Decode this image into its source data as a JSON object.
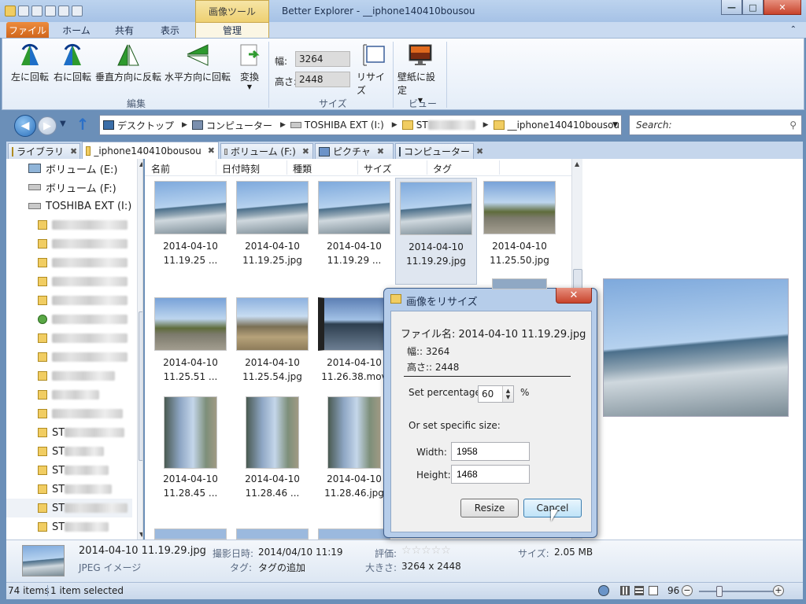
{
  "window": {
    "title": "Better Explorer - __iphone140410bousou",
    "contextual_tab_header": "画像ツール",
    "controls": {
      "minimize": "—",
      "maximize": "□",
      "close": "✕"
    }
  },
  "ribbon": {
    "tabs": [
      "ファイル",
      "ホーム",
      "共有",
      "表示",
      "管理"
    ],
    "active_tab": "管理",
    "groups": {
      "edit": {
        "label": "編集",
        "buttons": [
          "左に回転",
          "右に回転",
          "垂直方向に反転",
          "水平方向に回転",
          "変換"
        ]
      },
      "size": {
        "label": "サイズ",
        "width_label": "幅:",
        "width_value": "3264",
        "height_label": "高さ:",
        "height_value": "2448",
        "resize_label": "リサイズ"
      },
      "view": {
        "label": "ビュー",
        "wallpaper_label": "壁紙に設定"
      }
    }
  },
  "navbar": {
    "breadcrumbs": [
      "デスクトップ",
      "コンピューター",
      "TOSHIBA EXT (I:)",
      "ST",
      "__iphone140410bousou"
    ],
    "search_placeholder": "Search:"
  },
  "tabs": [
    {
      "label": "ライブラリ",
      "active": false
    },
    {
      "label": "_iphone140410bousou",
      "active": true
    },
    {
      "label": "ボリューム (F:)",
      "active": false
    },
    {
      "label": "ピクチャ",
      "active": false
    },
    {
      "label": "コンピューター",
      "active": false
    }
  ],
  "nav_pane": {
    "drives": [
      "ボリューム (E:)",
      "ボリューム (F:)",
      "TOSHIBA EXT (I:)"
    ],
    "folder_prefix": "ST"
  },
  "columns": [
    "名前",
    "日付時刻",
    "種類",
    "サイズ",
    "タグ"
  ],
  "files": [
    {
      "line1": "2014-04-10",
      "line2": "11.19.25 ...",
      "selected": false
    },
    {
      "line1": "2014-04-10",
      "line2": "11.19.25.jpg",
      "selected": false
    },
    {
      "line1": "2014-04-10",
      "line2": "11.19.29 ...",
      "selected": false
    },
    {
      "line1": "2014-04-10",
      "line2": "11.19.29.jpg",
      "selected": true
    },
    {
      "line1": "2014-04-10",
      "line2": "11.25.50.jpg",
      "selected": false
    },
    {
      "line1": "2014-04-10",
      "line2": "11.25.51 ...",
      "selected": false
    },
    {
      "line1": "2014-04-10",
      "line2": "11.25.54.jpg",
      "selected": false
    },
    {
      "line1": "2014-04-10",
      "line2": "11.26.38.mov",
      "selected": false
    },
    {
      "line1": "2014-04-10",
      "line2": "11.28.45 ...",
      "selected": false
    },
    {
      "line1": "2014-04-10",
      "line2": "11.28.46 ...",
      "selected": false
    },
    {
      "line1": "2014-04-10",
      "line2": "11.28.46.jpg",
      "selected": false
    }
  ],
  "details": {
    "filename": "2014-04-10 11.19.29.jpg",
    "type": "JPEG イメージ",
    "date_label": "撮影日時:",
    "date_value": "2014/04/10 11:19",
    "tag_label": "タグ:",
    "tag_value": "タグの追加",
    "rating_label": "評価:",
    "dimensions_label": "大きさ:",
    "dimensions_value": "3264 x 2448",
    "size_label": "サイズ:",
    "size_value": "2.05 MB",
    "rating_stars": 0
  },
  "statusbar": {
    "item_count": "74 items",
    "selected": "1 item selected",
    "zoom": "96"
  },
  "dialog": {
    "title": "画像をリサイズ",
    "filename_label": "ファイル名: 2014-04-10 11.19.29.jpg",
    "width_line": "幅:: 3264",
    "height_line": "高さ:: 2448",
    "set_percentage_label": "Set percentage:",
    "percentage_value": "60",
    "percent_sign": "%",
    "specific_size_label": "Or set specific size:",
    "width_label": "Width:",
    "width_value": "1958",
    "height_label": "Height:",
    "height_value": "1468",
    "resize_button": "Resize",
    "cancel_button": "Cancel"
  }
}
